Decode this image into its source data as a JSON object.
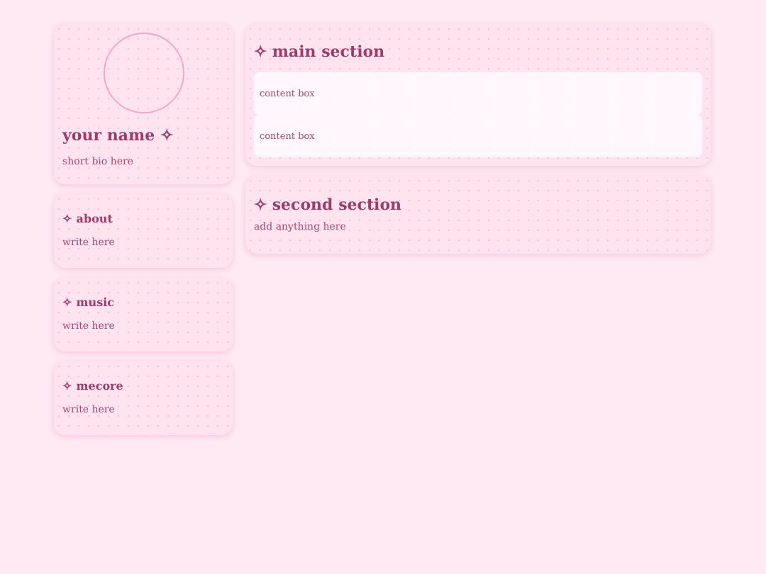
{
  "profile": {
    "name": "your name ✧",
    "bio": "short bio here"
  },
  "side_cards": [
    {
      "title": "✧ about",
      "text": "write here"
    },
    {
      "title": "✧ music",
      "text": "write here"
    },
    {
      "title": "✧ mecore",
      "text": "write here"
    }
  ],
  "main_section": {
    "title": "✧ main section",
    "boxes": [
      "content box",
      "content box"
    ]
  },
  "second_section": {
    "title": "✧ second section",
    "text": "add anything here"
  }
}
